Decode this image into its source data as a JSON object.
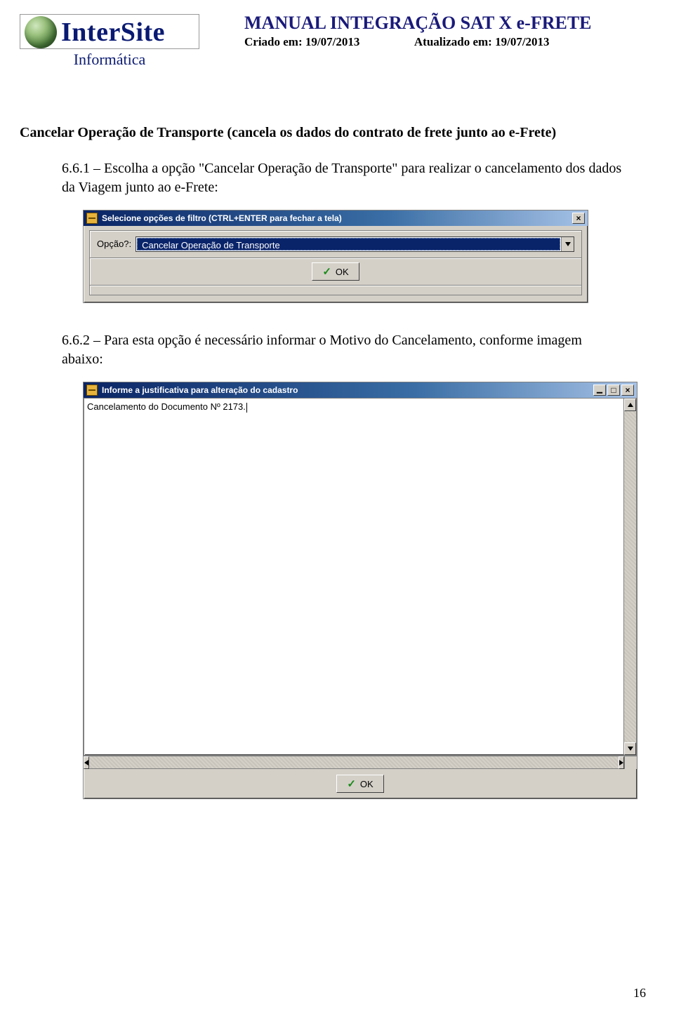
{
  "header": {
    "brand": "InterSite",
    "brand_sub": "Informática",
    "title": "MANUAL INTEGRAÇÃO SAT X e-FRETE",
    "created_label": "Criado em:",
    "created_value": "19/07/2013",
    "updated_label": "Atualizado em:",
    "updated_value": "19/07/2013"
  },
  "section": {
    "heading": "Cancelar Operação de Transporte (cancela os dados do contrato de frete junto ao e-Frete)",
    "p661": "6.6.1 – Escolha a opção \"Cancelar Operação de Transporte\" para realizar o cancelamento dos dados da Viagem junto ao e-Frete:",
    "p662": "6.6.2 – Para esta opção é necessário informar o Motivo do Cancelamento, conforme imagem abaixo:"
  },
  "dialog_filter": {
    "title": "Selecione opções de filtro (CTRL+ENTER para fechar a tela)",
    "field_label": "Opção?:",
    "combo_value": "Cancelar Operação de Transporte",
    "ok_label": "OK"
  },
  "dialog_just": {
    "title": "Informe a justificativa para alteração do cadastro",
    "text_value": "Cancelamento do Documento Nº 2173.",
    "ok_label": "OK"
  },
  "page_number": "16"
}
